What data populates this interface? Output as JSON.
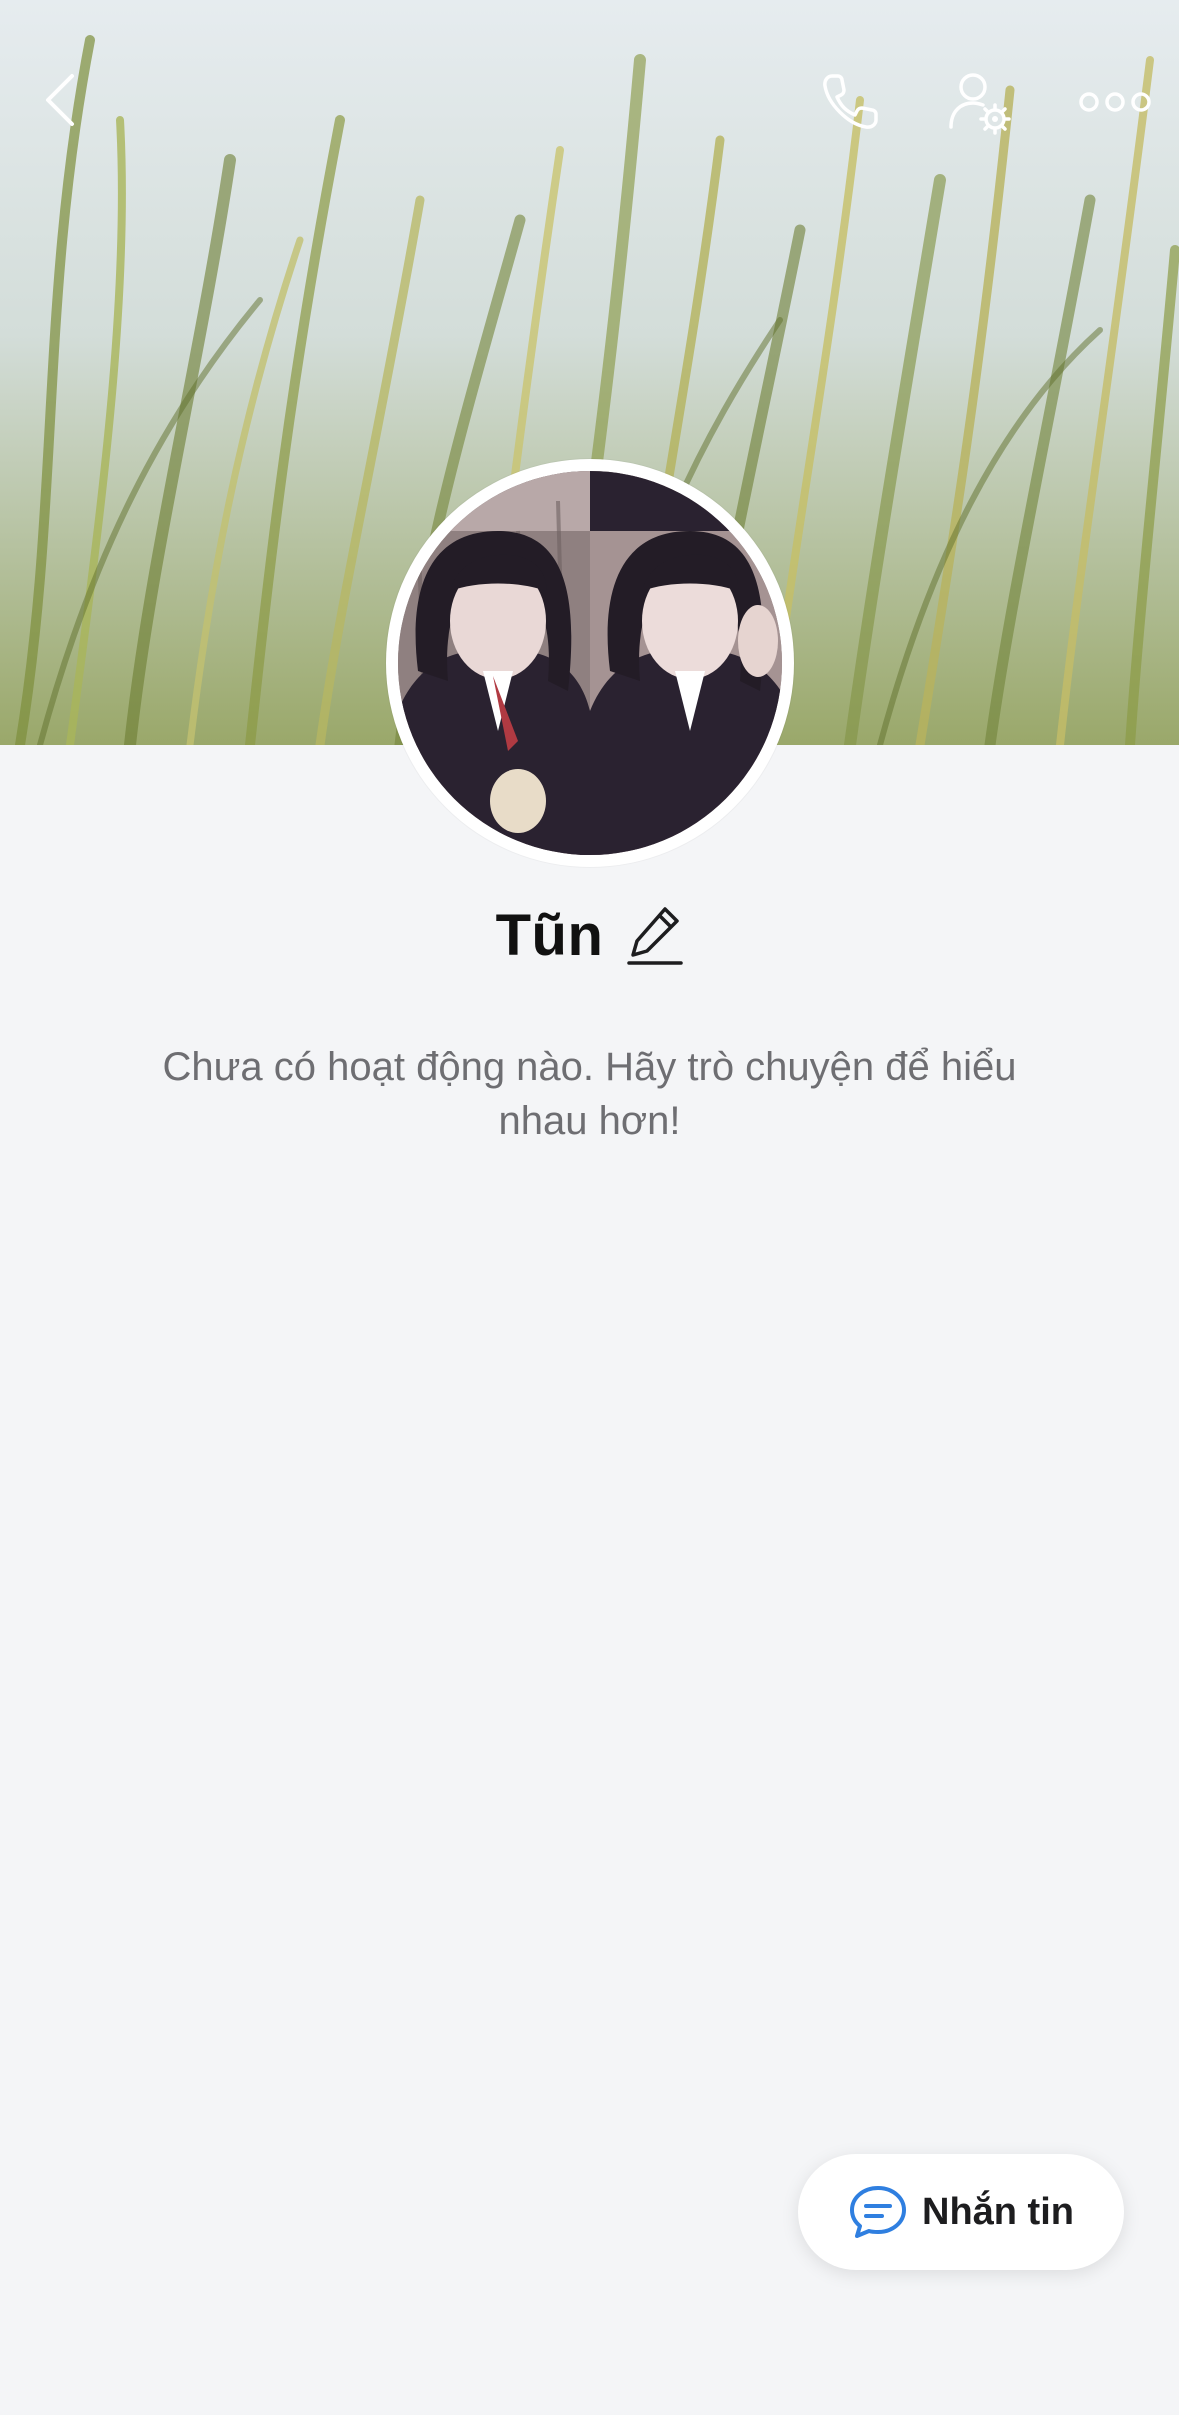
{
  "header": {
    "back_icon": "chevron-left-icon",
    "call_icon": "phone-icon",
    "profile_settings_icon": "user-gear-icon",
    "more_icon": "more-dots-icon"
  },
  "profile": {
    "name": "Tũn",
    "edit_icon": "pencil-icon",
    "empty_message": "Chưa có hoạt động nào. Hãy trò chuyện để hiểu nhau hơn!"
  },
  "actions": {
    "message_label": "Nhắn tin",
    "message_icon": "chat-bubble-icon"
  },
  "colors": {
    "accent": "#2f7fe0",
    "background": "#f4f5f7",
    "text_primary": "#111111",
    "text_secondary": "#6e6e72"
  }
}
